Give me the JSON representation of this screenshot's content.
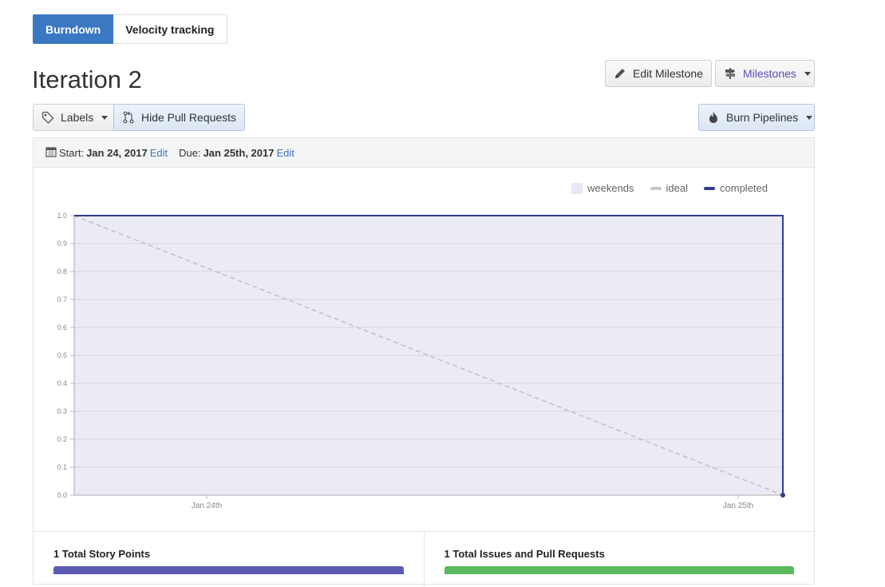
{
  "tabs": [
    {
      "label": "Burndown",
      "active": true
    },
    {
      "label": "Velocity tracking",
      "active": false
    }
  ],
  "page_title": "Iteration 2",
  "toolbar": {
    "edit_milestone": "Edit Milestone",
    "milestones": "Milestones",
    "labels": "Labels",
    "hide_pull_requests": "Hide Pull Requests",
    "burn_pipelines": "Burn Pipelines"
  },
  "dates": {
    "start_label": "Start:",
    "start_value": "Jan 24, 2017",
    "start_edit": "Edit",
    "due_label": "Due:",
    "due_value": "Jan 25th, 2017",
    "due_edit": "Edit"
  },
  "legend": {
    "weekends": "weekends",
    "ideal": "ideal",
    "completed": "completed"
  },
  "colors": {
    "accent": "#3b78c3",
    "completed": "#2f3d8c",
    "plot_bg": "#ebebf5",
    "ideal": "#c0c0cc",
    "story_points_bar": "#5b5bb3",
    "issues_bar": "#5cb85c"
  },
  "chart_data": {
    "type": "line",
    "x_ticks": [
      "Jan 24th",
      "Jan 25th"
    ],
    "ylim": [
      0,
      1
    ],
    "y_ticks": [
      "0.0",
      "0.1",
      "0.2",
      "0.3",
      "0.4",
      "0.5",
      "0.6",
      "0.7",
      "0.8",
      "0.9",
      "1.0"
    ],
    "series": [
      {
        "name": "ideal",
        "x": [
          "Jan 24th start",
          "Jan 25th end"
        ],
        "values": [
          1.0,
          0.0
        ],
        "style": "dashed"
      },
      {
        "name": "completed",
        "x": [
          "Jan 24th start",
          "Jan 25th end",
          "Jan 25th end"
        ],
        "values": [
          1.0,
          1.0,
          0.0
        ],
        "style": "solid"
      }
    ],
    "grid": true,
    "legend_position": "top-right"
  },
  "stats": {
    "story_points": "1 Total Story Points",
    "issues": "1 Total Issues and Pull Requests"
  }
}
